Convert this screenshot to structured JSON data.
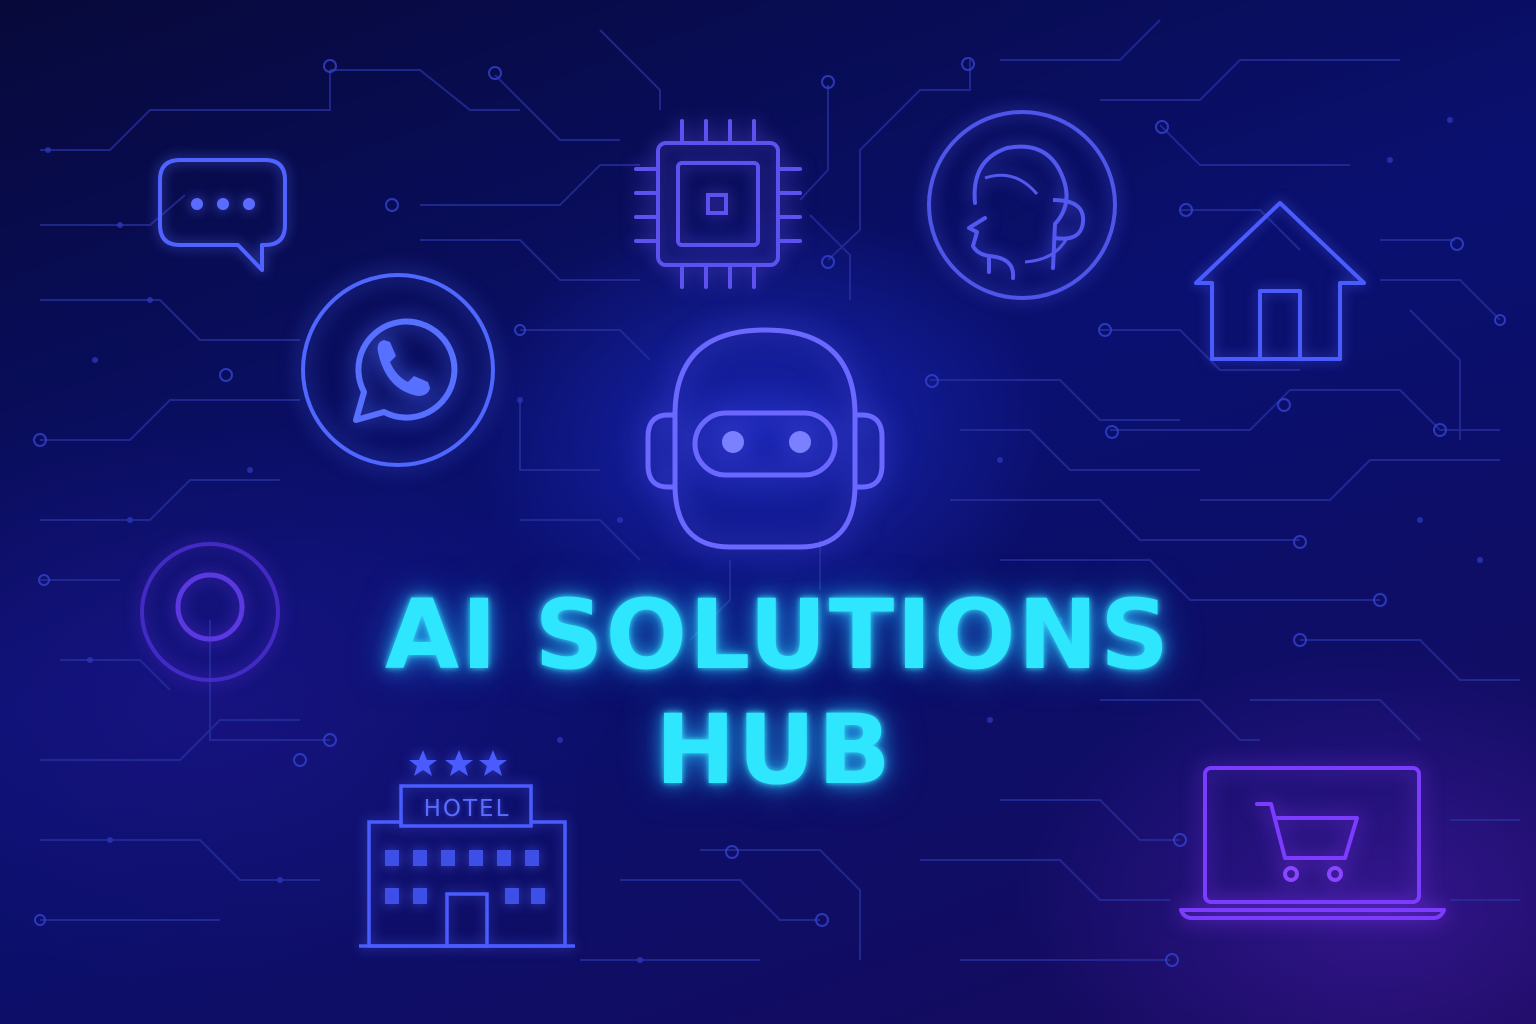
{
  "title": {
    "line1": "AI SOLUTIONS",
    "line2": "HUB"
  },
  "hotel_sign": "HOTEL",
  "colors": {
    "background_dark": "#07093a",
    "background_mid": "#0b0f6a",
    "accent_violet": "#7b3cff",
    "icon_blue": "#4a5cff",
    "title_cyan": "#2fe6ff",
    "circuit_line": "#2631a8"
  },
  "icons": [
    "chat-bubble-icon",
    "whatsapp-icon",
    "microchip-icon",
    "support-agent-icon",
    "home-icon",
    "robot-head-icon",
    "target-ring-icon",
    "hotel-icon",
    "laptop-cart-icon"
  ],
  "hotel_stars": 3
}
